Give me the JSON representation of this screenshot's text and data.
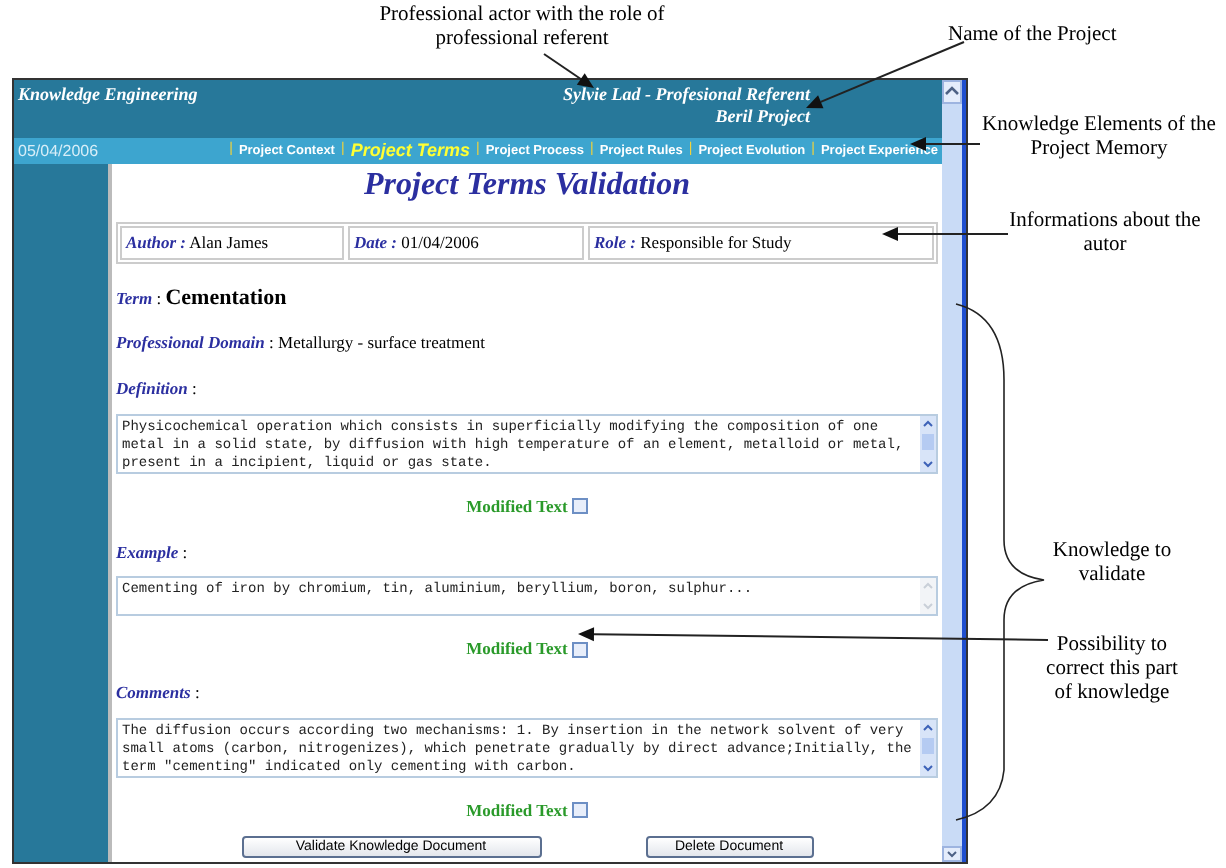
{
  "annotations": [
    {
      "kind": "top",
      "text": "Professional actor with the role of professional referent"
    },
    {
      "kind": "project",
      "text": "Name of the Project"
    },
    {
      "kind": "elements",
      "text": "Knowledge Elements of the Project Memory"
    },
    {
      "kind": "author",
      "text": "Informations about the autor"
    },
    {
      "kind": "validate",
      "text": "Knowledge to validate"
    },
    {
      "kind": "correct",
      "text": "Possibility to correct this part of knowledge"
    }
  ],
  "header": {
    "app_title": "Knowledge Engineering",
    "user": "Sylvie Lad - Profesional Referent",
    "project": "Beril Project"
  },
  "nav": {
    "date": "05/04/2006",
    "separator": "|",
    "items": [
      {
        "label": "Project Context",
        "selected": false
      },
      {
        "label": "Project Terms",
        "selected": true
      },
      {
        "label": "Project Process",
        "selected": false
      },
      {
        "label": "Project Rules",
        "selected": false
      },
      {
        "label": "Project Evolution",
        "selected": false
      },
      {
        "label": "Project Experience",
        "selected": false
      }
    ]
  },
  "page_title": "Project Terms Validation",
  "info": [
    {
      "label": "Author :",
      "value": "Alan James"
    },
    {
      "label": "Date :",
      "value": "01/04/2006"
    },
    {
      "label": "Role :",
      "value": "Responsible for Study"
    }
  ],
  "term": {
    "label": "Term",
    "separator": ":",
    "value": "Cementation"
  },
  "domain": {
    "label": "Professional Domain",
    "separator": ":",
    "value": "Metallurgy - surface treatment"
  },
  "sections": [
    {
      "label": "Definition",
      "separator": ":",
      "text": "Physicochemical operation which consists in superficially modifying the composition of one metal in a solid state, by diffusion with high temperature of an element, metalloid or metal, present in a incipient, liquid or gas state.",
      "scrollable": true,
      "modified_label": "Modified Text",
      "modified": false
    },
    {
      "label": "Example",
      "separator": ":",
      "text": "Cementing of iron by chromium, tin, aluminium, beryllium, boron, sulphur...",
      "scrollable": false,
      "modified_label": "Modified Text",
      "modified": false
    },
    {
      "label": "Comments",
      "separator": ":",
      "text": "The diffusion occurs according two mechanisms: 1. By insertion in the network solvent of very small atoms (carbon, nitrogenizes), which penetrate gradually by direct advance;Initially, the term \"cementing\" indicated only cementing with carbon.",
      "scrollable": true,
      "modified_label": "Modified Text",
      "modified": false
    }
  ],
  "buttons": [
    "Validate Knowledge Document",
    "Delete Document"
  ]
}
